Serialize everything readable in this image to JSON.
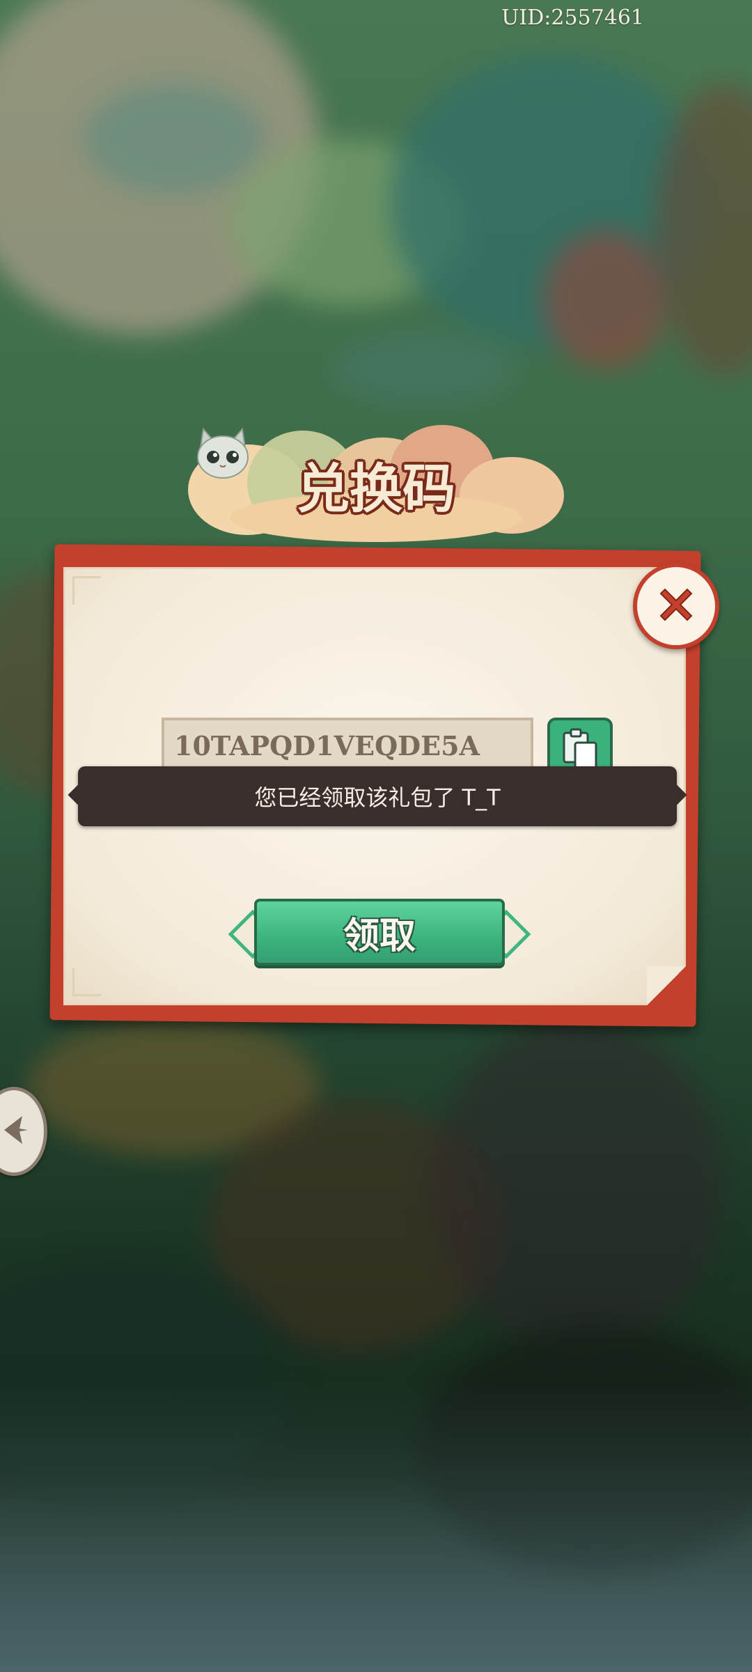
{
  "header": {
    "uid": "UID:2557461"
  },
  "dialog": {
    "title": "兑换码",
    "code_value": "10TAPQD1VEQDE5A",
    "toast": "您已经领取该礼包了 T_T",
    "claim_label": "领取"
  },
  "icons": {
    "close": "close-icon",
    "paste": "clipboard-icon",
    "side": "back-arrow-icon",
    "mascot": "cat-mascot-icon"
  },
  "colors": {
    "frame_red": "#c4402c",
    "claim_green": "#3fb580",
    "toast_bg": "#3a2e2c",
    "paper": "#f3ead9"
  }
}
